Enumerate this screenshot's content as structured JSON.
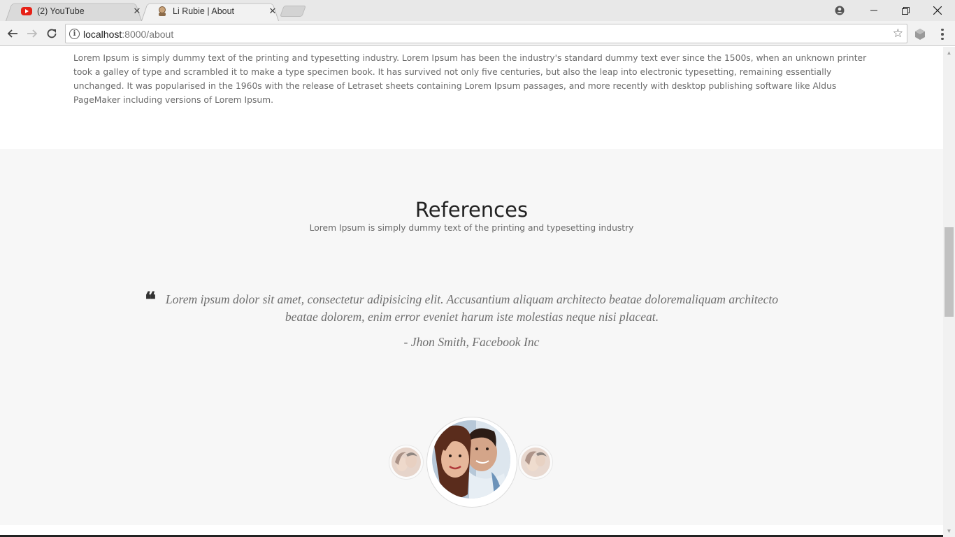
{
  "browser": {
    "tabs": [
      {
        "title": "(2) YouTube",
        "icon": "youtube-icon",
        "active": false
      },
      {
        "title": "Li Rubie | About",
        "icon": "site-favicon",
        "active": true
      }
    ],
    "url_host": "localhost",
    "url_path": ":8000/about"
  },
  "page": {
    "about_paragraph": "Lorem Ipsum is simply dummy text of the printing and typesetting industry. Lorem Ipsum has been the industry's standard dummy text ever since the 1500s, when an unknown printer took a galley of type and scrambled it to make a type specimen book. It has survived not only five centuries, but also the leap into electronic typesetting, remaining essentially unchanged. It was popularised in the 1960s with the release of Letraset sheets containing Lorem Ipsum passages, and more recently with desktop publishing software like Aldus PageMaker including versions of Lorem Ipsum.",
    "references": {
      "title": "References",
      "subtitle": "Lorem Ipsum is simply dummy text of the printing and typesetting industry",
      "quote": "Lorem ipsum dolor sit amet, consectetur adipisicing elit. Accusantium aliquam architecto beatae doloremaliquam architecto beatae dolorem, enim error eveniet harum iste molestias neque nisi placeat.",
      "author": "- Jhon Smith, Facebook Inc"
    }
  },
  "colors": {
    "section_bg": "#f7f7f7",
    "text_gray": "#6a6a6a",
    "youtube_red": "#e62117"
  }
}
